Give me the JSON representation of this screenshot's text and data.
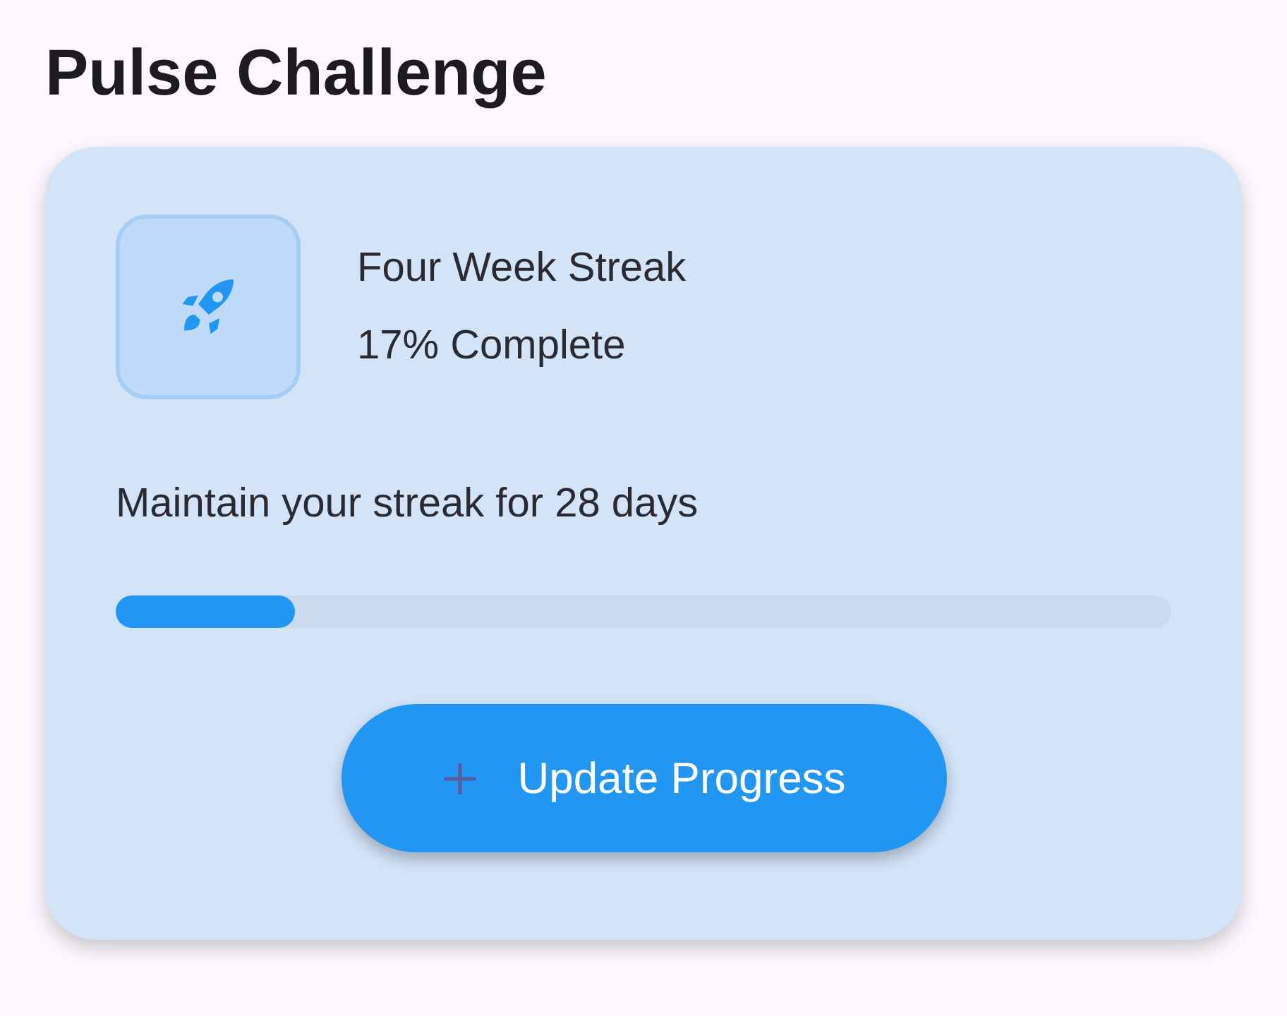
{
  "title": "Pulse Challenge",
  "challenge": {
    "name": "Four Week Streak",
    "status": "17% Complete",
    "description": "Maintain your streak for 28 days",
    "level": 0.17
  },
  "button": {
    "label": "Update Progress"
  }
}
